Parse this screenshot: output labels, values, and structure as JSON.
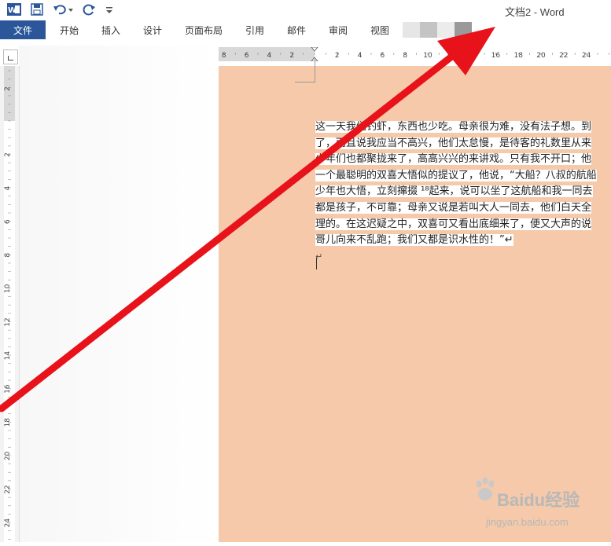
{
  "window": {
    "title": "文档2 - Word"
  },
  "quick_access": {
    "icons": [
      "word-logo-icon",
      "save-icon",
      "undo-icon",
      "redo-icon",
      "customize-icon"
    ],
    "word_logo_letter": "W"
  },
  "ribbon": {
    "file_tab": "文件",
    "tabs": [
      "开始",
      "插入",
      "设计",
      "页面布局",
      "引用",
      "邮件",
      "审阅",
      "视图"
    ]
  },
  "rulers": {
    "horizontal_labels": [
      "8",
      "6",
      "4",
      "2",
      "2",
      "4",
      "6",
      "8",
      "10",
      "12",
      "14",
      "16",
      "18",
      "20",
      "22",
      "24"
    ],
    "vertical_labels": [
      "2",
      "2",
      "4",
      "6",
      "8",
      "10",
      "12",
      "14",
      "16",
      "18",
      "20",
      "22",
      "24"
    ]
  },
  "document": {
    "page_color": "#f5c9a9",
    "lines": [
      "这一天我们钓虾，东西也少吃。母亲很为难，没有法子想。到",
      "了，而且说我应当不高兴，他们太怠慢，是待客的礼数里从来",
      "少年们也都聚拢来了，高高兴兴的来讲戏。只有我不开口；他",
      "一个最聪明的双喜大悟似的提议了，他说，“大船？八叔的航船",
      "少年也大悟，立刻撺掇 ¹⁸起来，说可以坐了这航船和我一同去",
      "都是孩子，不可靠；母亲又说是若叫大人一同去，他们白天全",
      "理的。在这迟疑之中，双喜可又看出底细来了，便又大声的说",
      "哥儿向来不乱跑；我们又都是识水性的！”↵"
    ],
    "empty_paragraph_mark": "↵"
  },
  "watermark": {
    "brand": "Baidu经验",
    "url": "jingyan.baidu.com"
  },
  "annotation": {
    "arrow_color": "#e8121a"
  }
}
